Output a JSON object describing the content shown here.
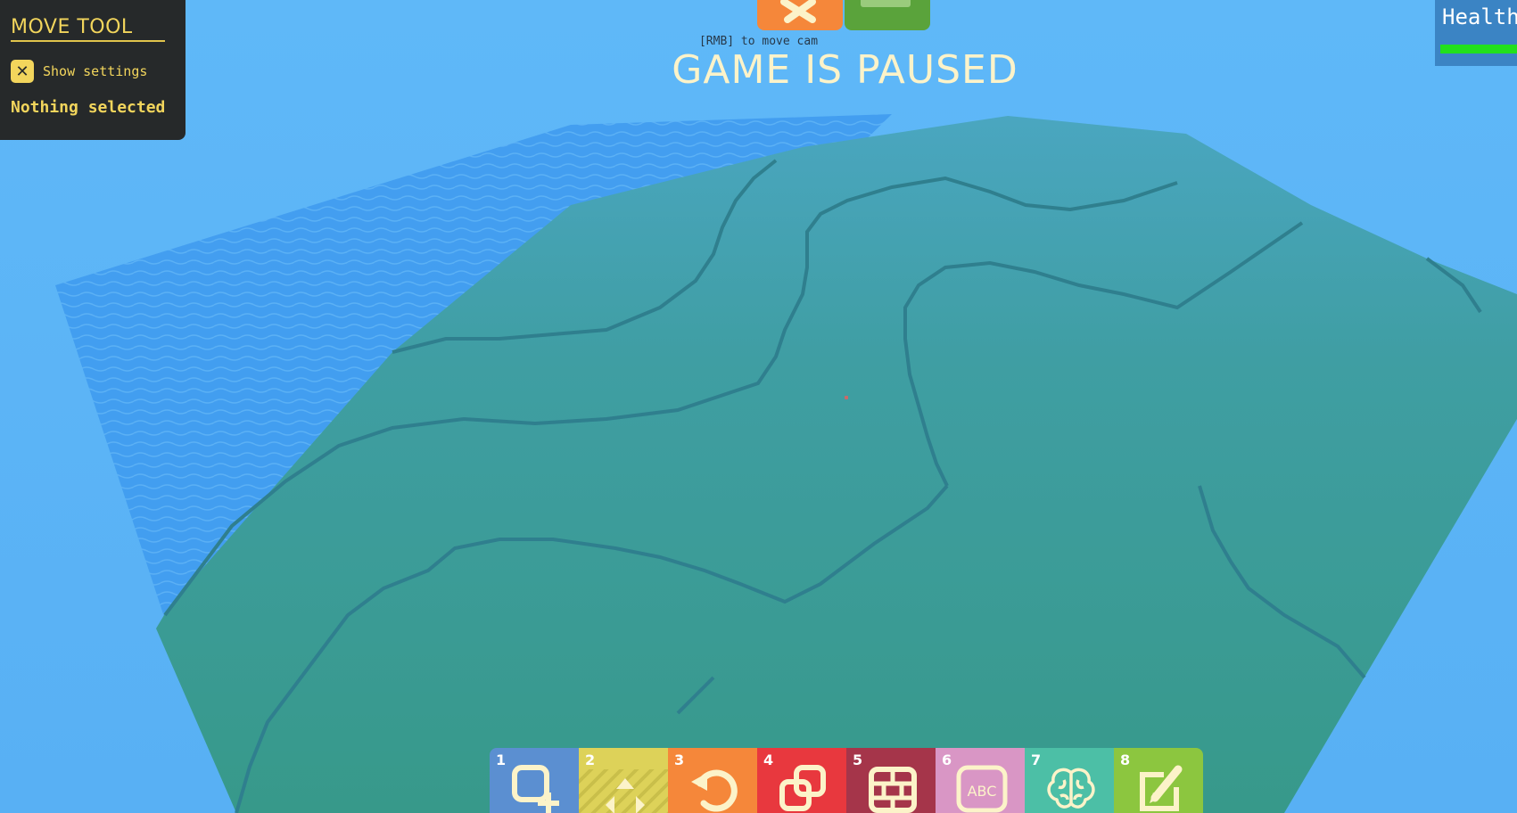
{
  "tool_panel": {
    "title": "MOVE TOOL",
    "show_settings_label": "Show settings",
    "show_settings_checked": true,
    "checkbox_icon": "close-icon",
    "selection_status": "Nothing selected"
  },
  "top_bar": {
    "tabs": [
      {
        "name": "build-tab",
        "icon": "wrench-icon",
        "color": "#f5873a"
      },
      {
        "name": "play-tab",
        "icon": "play-icon",
        "color": "#5aa33b"
      }
    ],
    "hint": "[RMB] to move cam",
    "status_title": "GAME IS PAUSED"
  },
  "health": {
    "label": "Health",
    "level": 1.0,
    "bar_color": "#22e01c"
  },
  "hotbar": {
    "slots": [
      {
        "key": "1",
        "icon": "add-shape-icon",
        "color": "#5b8fd1"
      },
      {
        "key": "2",
        "icon": "move-arrows-icon",
        "color": "#ddd259"
      },
      {
        "key": "3",
        "icon": "rotate-icon",
        "color": "#f5873a"
      },
      {
        "key": "4",
        "icon": "duplicate-icon",
        "color": "#e8383e"
      },
      {
        "key": "5",
        "icon": "brick-wall-icon",
        "color": "#a5354a"
      },
      {
        "key": "6",
        "icon": "text-icon",
        "color": "#d996c5",
        "text": "ABC"
      },
      {
        "key": "7",
        "icon": "brain-icon",
        "color": "#4cbfa6"
      },
      {
        "key": "8",
        "icon": "edit-icon",
        "color": "#8cc63f"
      }
    ]
  },
  "colors": {
    "sky": "#5bb4f7",
    "terrain": "#3a9c8e",
    "water": "#3d98ef",
    "panel": "#26292a",
    "accent": "#f2d55c"
  }
}
